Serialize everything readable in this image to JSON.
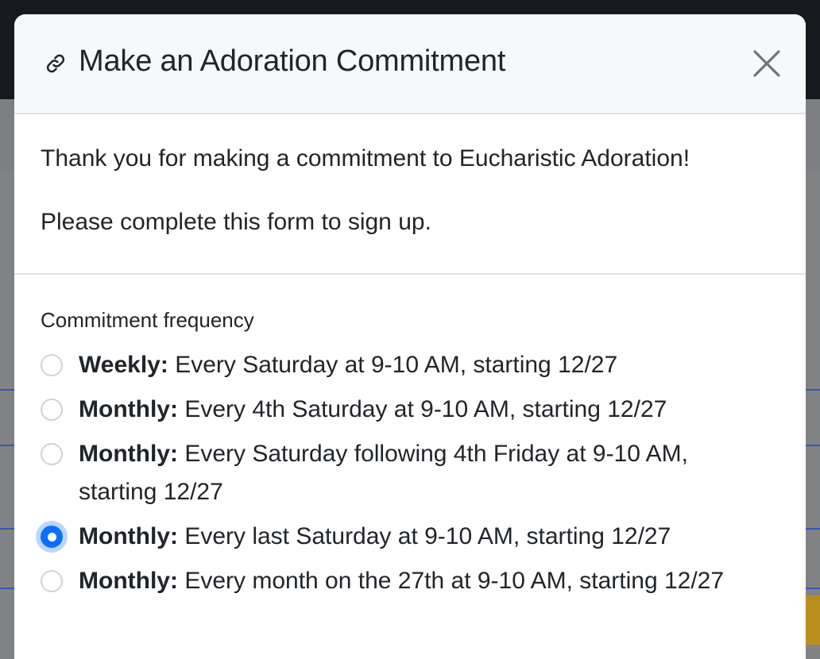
{
  "modal": {
    "title": "Make an Adoration Commitment",
    "icon": "link-icon",
    "close_icon": "close-icon"
  },
  "intro": {
    "thanks": "Thank you for making a commitment to Eucharistic Adoration!",
    "instruction": "Please complete this form to sign up."
  },
  "form": {
    "frequency_label": "Commitment frequency",
    "selected_index": 3,
    "options": [
      {
        "kind": "Weekly:",
        "detail": "Every Saturday at 9-10 AM, starting 12/27"
      },
      {
        "kind": "Monthly:",
        "detail": "Every 4th Saturday at 9-10 AM, starting 12/27"
      },
      {
        "kind": "Monthly:",
        "detail": "Every Saturday following 4th Friday at 9-10 AM, starting 12/27"
      },
      {
        "kind": "Monthly:",
        "detail": "Every last Saturday at 9-10 AM, starting 12/27"
      },
      {
        "kind": "Monthly:",
        "detail": "Every month on the 27th at 9-10 AM, starting 12/27"
      }
    ]
  },
  "colors": {
    "accent": "#0d6efd",
    "header_bg": "#f7f8fa",
    "text": "#212529"
  }
}
